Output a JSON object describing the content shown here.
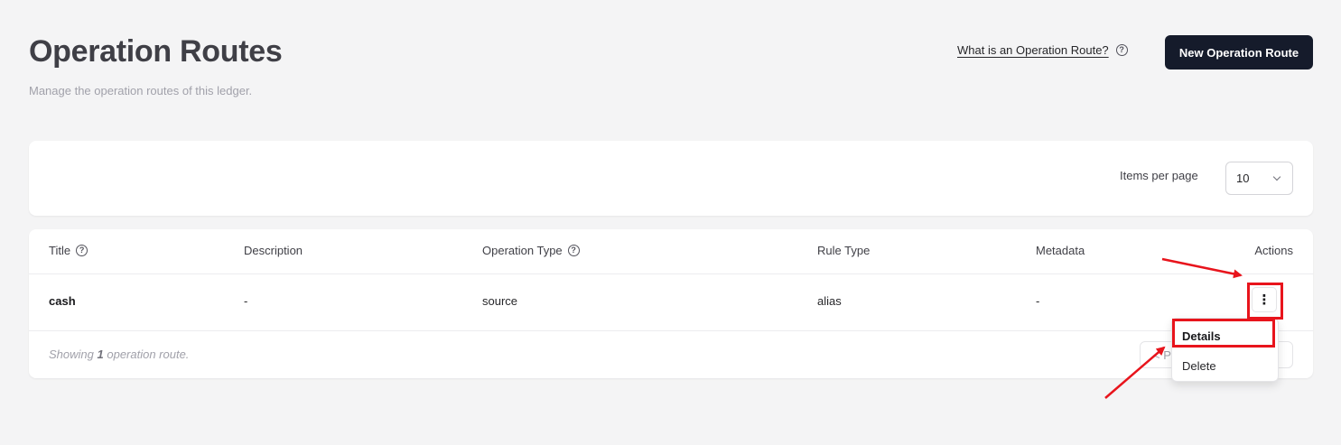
{
  "header": {
    "title": "Operation Routes",
    "subtitle": "Manage the operation routes of this ledger.",
    "help_link": "What is an Operation Route?",
    "new_button": "New Operation Route"
  },
  "filters": {
    "items_per_page_label": "Items per page",
    "items_per_page_value": "10"
  },
  "table": {
    "columns": [
      "Title",
      "Description",
      "Operation Type",
      "Rule Type",
      "Metadata",
      "Actions"
    ],
    "rows": [
      {
        "title": "cash",
        "description": "-",
        "operation_type": "source",
        "rule_type": "alias",
        "metadata": "-"
      }
    ],
    "footer": {
      "prefix": "Showing",
      "count": "1",
      "suffix": "operation route."
    },
    "pager_text": "< P"
  },
  "actions_menu": {
    "trigger_icon": "more-vertical-icon",
    "items": [
      "Details",
      "Delete"
    ]
  },
  "annotations": {
    "color": "#e8141c"
  },
  "colors": {
    "primary_button": "#151b2b",
    "background": "#f4f4f5"
  }
}
